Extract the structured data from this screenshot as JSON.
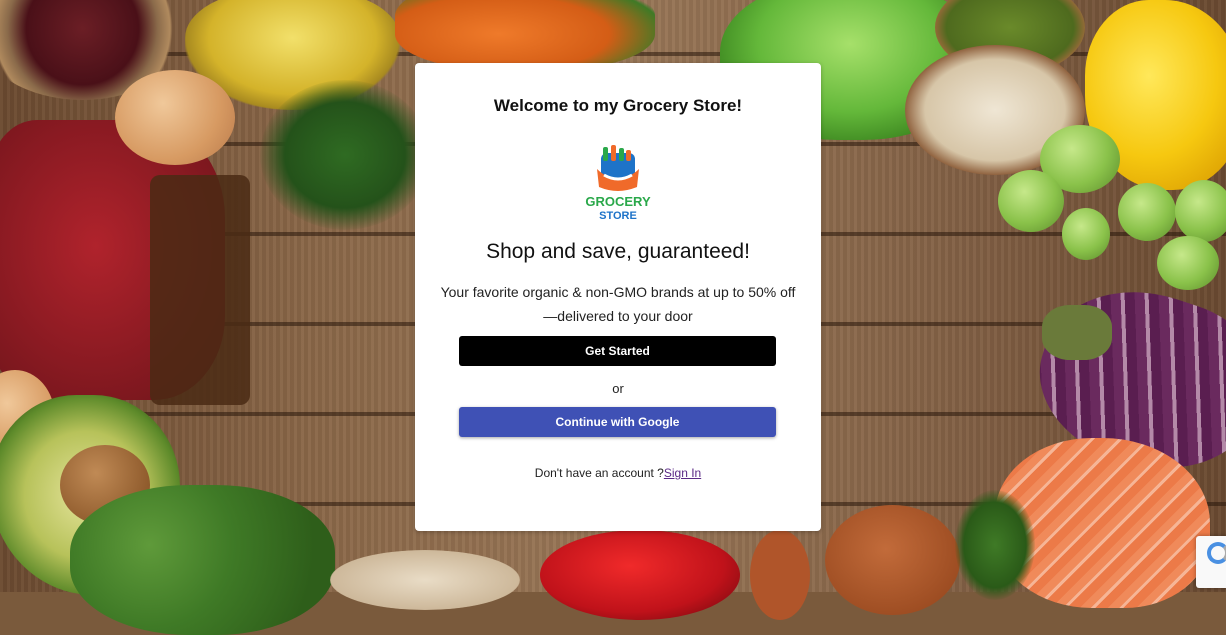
{
  "card": {
    "welcome": "Welcome to my Grocery Store!",
    "tagline": "Shop and save, guaranteed!",
    "description": "Your favorite organic & non-GMO brands at up to 50% off—delivered to your door",
    "get_started_label": "Get Started",
    "or_label": "or",
    "google_label": "Continue with Google",
    "no_account_text": "Don't have an account ?",
    "sign_in_label": "Sign In"
  },
  "logo": {
    "line1": "GROCERY",
    "line2": "STORE",
    "colors": {
      "green": "#2aa84a",
      "blue": "#1e73c8",
      "orange": "#f06a2a"
    }
  },
  "colors": {
    "get_started_bg": "#000000",
    "google_bg": "#3f51b5",
    "link": "#5b2a86"
  }
}
